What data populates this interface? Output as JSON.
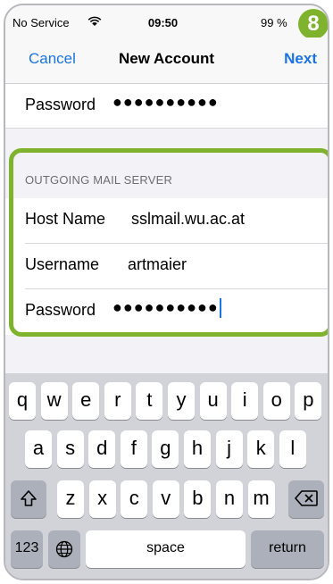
{
  "status_bar": {
    "carrier": "No Service",
    "time": "09:50",
    "battery": "99 %"
  },
  "step_badge": "8",
  "navbar": {
    "cancel": "Cancel",
    "title": "New Account",
    "next": "Next"
  },
  "incoming": {
    "password_label": "Password",
    "password_value": "●●●●●●●●●●"
  },
  "outgoing": {
    "header": "OUTGOING MAIL SERVER",
    "host_label": "Host Name",
    "host_value": "sslmail.wu.ac.at",
    "username_label": "Username",
    "username_value": "artmaier",
    "password_label": "Password",
    "password_value": "●●●●●●●●●●"
  },
  "colors": {
    "accent": "#1a73e8",
    "highlight": "#7fb32e"
  },
  "keyboard": {
    "row1": [
      "q",
      "w",
      "e",
      "r",
      "t",
      "y",
      "u",
      "i",
      "o",
      "p"
    ],
    "row2": [
      "a",
      "s",
      "d",
      "f",
      "g",
      "h",
      "j",
      "k",
      "l"
    ],
    "row3": [
      "z",
      "x",
      "c",
      "v",
      "b",
      "n",
      "m"
    ],
    "shift_icon": "shift-arrow-icon",
    "delete_icon": "delete-backspace-icon",
    "numbers": "123",
    "globe_icon": "globe-icon",
    "space": "space",
    "return": "return"
  }
}
